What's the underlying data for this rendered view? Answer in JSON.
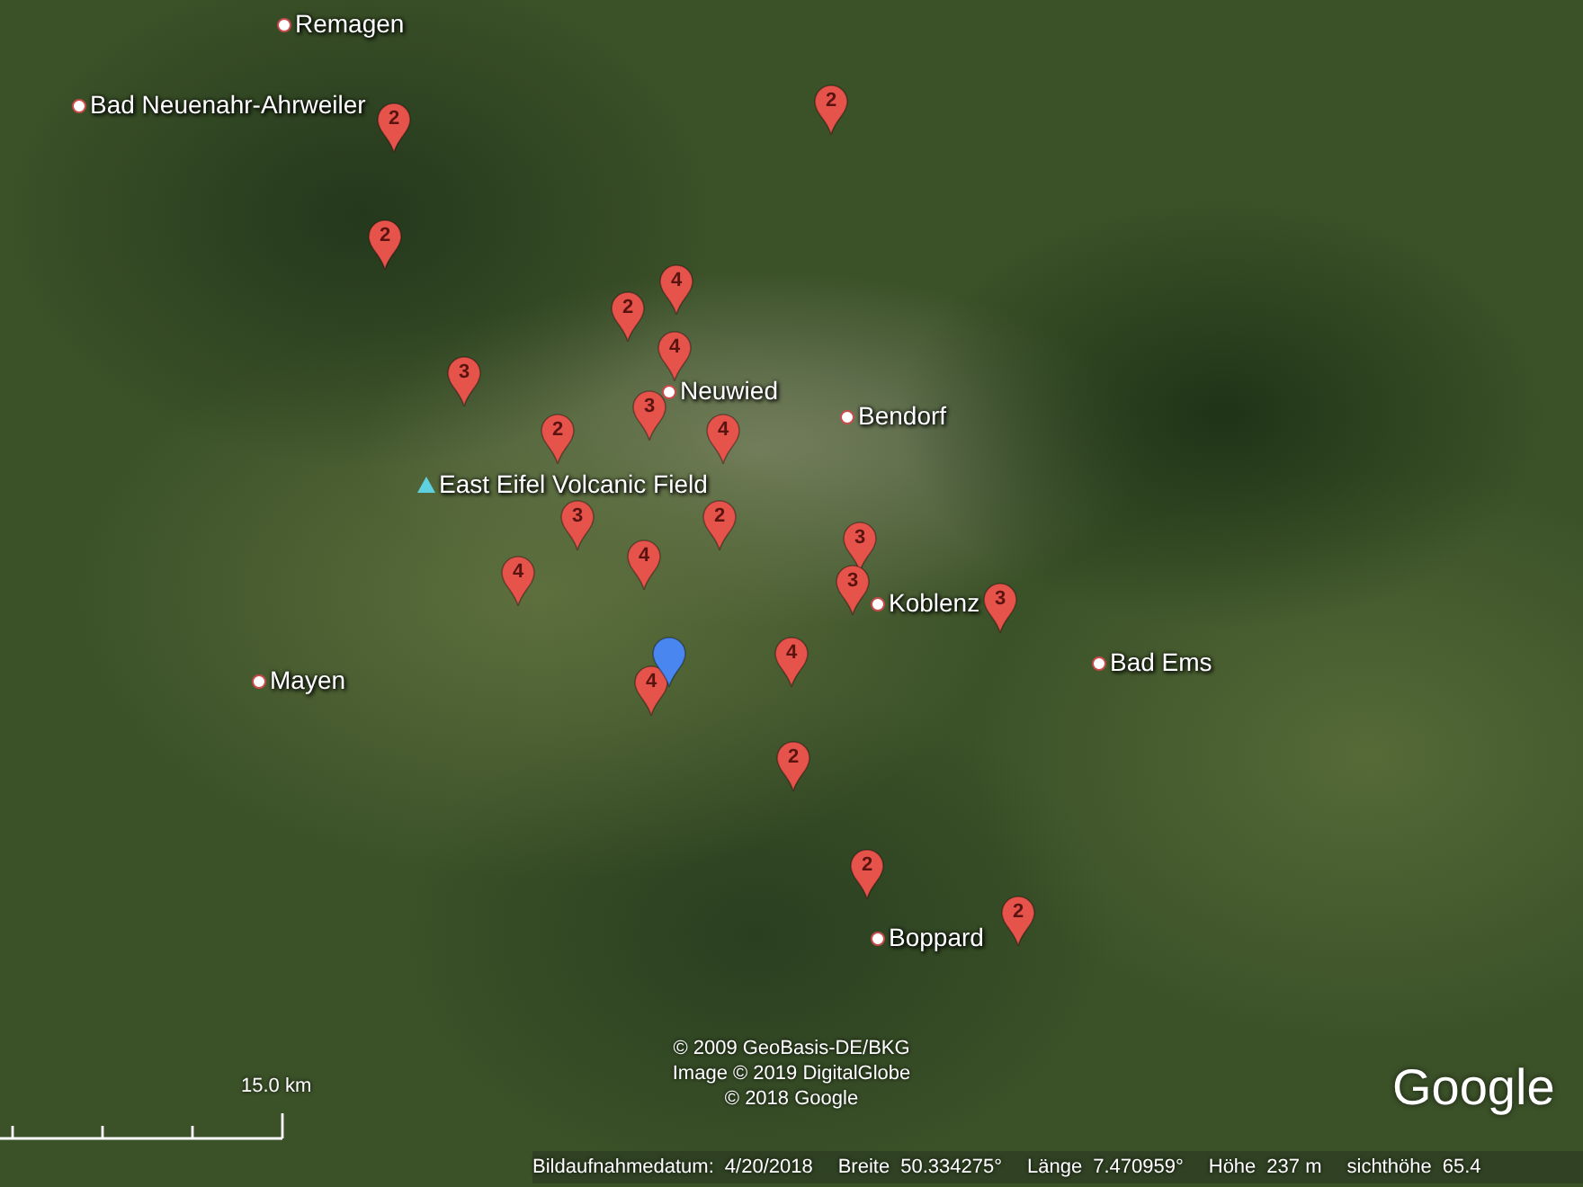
{
  "map": {
    "places": [
      {
        "name": "Remagen",
        "kind": "town"
      },
      {
        "name": "Bad Neuenahr-Ahrweiler",
        "kind": "town"
      },
      {
        "name": "Neuwied",
        "kind": "town"
      },
      {
        "name": "Bendorf",
        "kind": "town"
      },
      {
        "name": "East Eifel Volcanic Field",
        "kind": "landmark"
      },
      {
        "name": "Koblenz",
        "kind": "town"
      },
      {
        "name": "Mayen",
        "kind": "town"
      },
      {
        "name": "Bad Ems",
        "kind": "town"
      },
      {
        "name": "Boppard",
        "kind": "town"
      }
    ],
    "pins": [
      {
        "label": "2",
        "color": "#e5534b"
      },
      {
        "label": "2",
        "color": "#e5534b"
      },
      {
        "label": "2",
        "color": "#e5534b"
      },
      {
        "label": "4",
        "color": "#e5534b"
      },
      {
        "label": "2",
        "color": "#e5534b"
      },
      {
        "label": "3",
        "color": "#e5534b"
      },
      {
        "label": "4",
        "color": "#e5534b"
      },
      {
        "label": "3",
        "color": "#e5534b"
      },
      {
        "label": "4",
        "color": "#e5534b"
      },
      {
        "label": "2",
        "color": "#e5534b"
      },
      {
        "label": "2",
        "color": "#e5534b"
      },
      {
        "label": "3",
        "color": "#e5534b"
      },
      {
        "label": "4",
        "color": "#e5534b"
      },
      {
        "label": "4",
        "color": "#e5534b"
      },
      {
        "label": "3",
        "color": "#e5534b"
      },
      {
        "label": "3",
        "color": "#e5534b"
      },
      {
        "label": "3",
        "color": "#e5534b"
      },
      {
        "label": "4",
        "color": "#e5534b"
      },
      {
        "label": "4",
        "color": "#e5534b"
      },
      {
        "color": "#4a86f0"
      },
      {
        "label": "2",
        "color": "#e5534b"
      },
      {
        "label": "2",
        "color": "#e5534b"
      },
      {
        "label": "2",
        "color": "#e5534b"
      }
    ],
    "attribution": [
      "© 2009 GeoBasis-DE/BKG",
      "Image © 2019 DigitalGlobe",
      "© 2018 Google"
    ],
    "scale": "15.0 km",
    "logo": "Google"
  },
  "status_bar": [
    {
      "label": "Bildaufnahmedatum:",
      "value": "4/20/2018"
    },
    {
      "label": "Breite",
      "value": "50.334275°"
    },
    {
      "label": "Länge",
      "value": "7.470959°"
    },
    {
      "label": "Höhe",
      "value": "237 m"
    },
    {
      "label": "sichthöhe",
      "value": "65.4"
    }
  ]
}
